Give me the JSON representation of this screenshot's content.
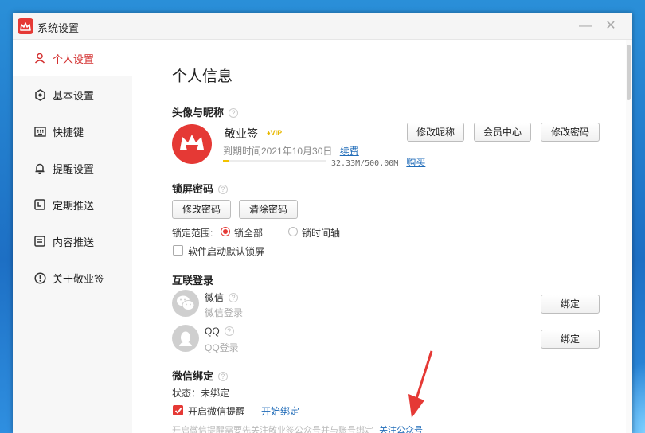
{
  "window": {
    "title": "系统设置"
  },
  "sidebar": {
    "items": [
      {
        "label": "个人设置",
        "icon": "person-icon",
        "active": true
      },
      {
        "label": "基本设置",
        "icon": "settings-icon"
      },
      {
        "label": "快捷键",
        "icon": "keyboard-icon"
      },
      {
        "label": "提醒设置",
        "icon": "bell-icon"
      },
      {
        "label": "定期推送",
        "icon": "schedule-icon"
      },
      {
        "label": "内容推送",
        "icon": "document-icon"
      },
      {
        "label": "关于敬业签",
        "icon": "info-icon"
      }
    ]
  },
  "page": {
    "title": "个人信息"
  },
  "profile": {
    "section_title": "头像与昵称",
    "nickname": "敬业签",
    "vip_label": "VIP",
    "expire_text": "到期时间2021年10月30日",
    "renew_label": "续费",
    "storage_text": "32.33M/500.00M",
    "storage_fraction": 0.065,
    "buy_label": "购买",
    "buttons": {
      "edit_nickname": "修改昵称",
      "member_center": "会员中心",
      "change_password": "修改密码"
    }
  },
  "lock_screen": {
    "section_title": "锁屏密码",
    "change_password": "修改密码",
    "clear_password": "清除密码",
    "scope_label": "锁定范围:",
    "option_all": "锁全部",
    "option_timeline": "锁时间轴",
    "selected": "all",
    "startup_lock_label": "软件启动默认锁屏",
    "startup_lock_checked": false
  },
  "linked_login": {
    "section_title": "互联登录",
    "wechat": {
      "name": "微信",
      "sub": "微信登录",
      "bind_label": "绑定"
    },
    "qq": {
      "name": "QQ",
      "sub": "QQ登录",
      "bind_label": "绑定"
    }
  },
  "wechat_bind": {
    "section_title": "微信绑定",
    "status_text": "状态：未绑定",
    "reminder_label": "开启微信提醒",
    "reminder_checked": true,
    "start_bind_label": "开始绑定",
    "hint_text": "开启微信提醒需要先关注敬业签公众号并与账号绑定",
    "follow_label": "关注公众号"
  },
  "colors": {
    "accent": "#e53935",
    "link": "#1f6bb8",
    "vip": "#e8b800"
  }
}
